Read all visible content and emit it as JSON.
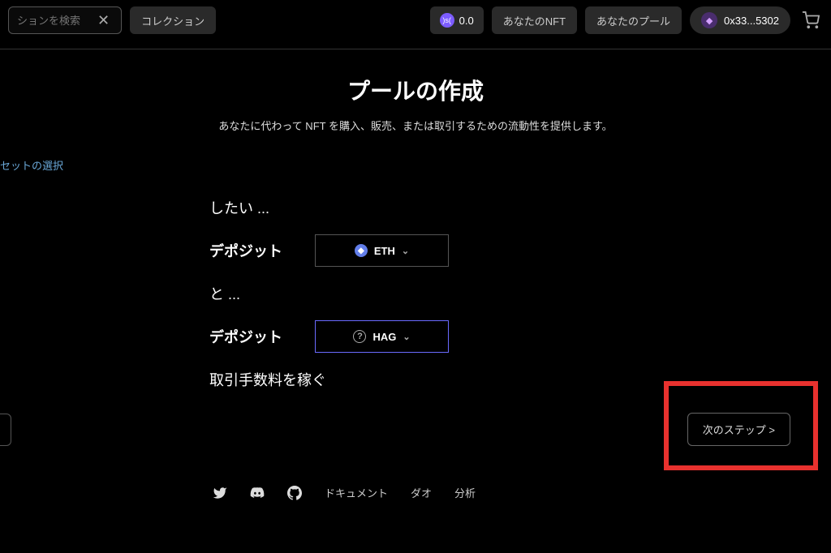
{
  "topbar": {
    "search_placeholder": "ションを検索",
    "collection_label": "コレクション",
    "balance_value": "0.0",
    "nav_your_nft": "あなたのNFT",
    "nav_your_pool": "あなたのプール",
    "wallet_address": "0x33...5302"
  },
  "page": {
    "title": "プールの作成",
    "subtitle": "あなたに代わって NFT を購入、販売、または取引するための流動性を提供します。",
    "step_label": "セットの選択"
  },
  "form": {
    "want_label": "したい ...",
    "deposit_label_1": "デポジット",
    "asset_1": "ETH",
    "and_label": "と ...",
    "deposit_label_2": "デポジット",
    "asset_2": "HAG",
    "fee_text": "取引手数料を稼ぐ",
    "next_button": "次のステップ >"
  },
  "footer": {
    "link_docs": "ドキュメント",
    "link_dao": "ダオ",
    "link_analytics": "分析"
  }
}
